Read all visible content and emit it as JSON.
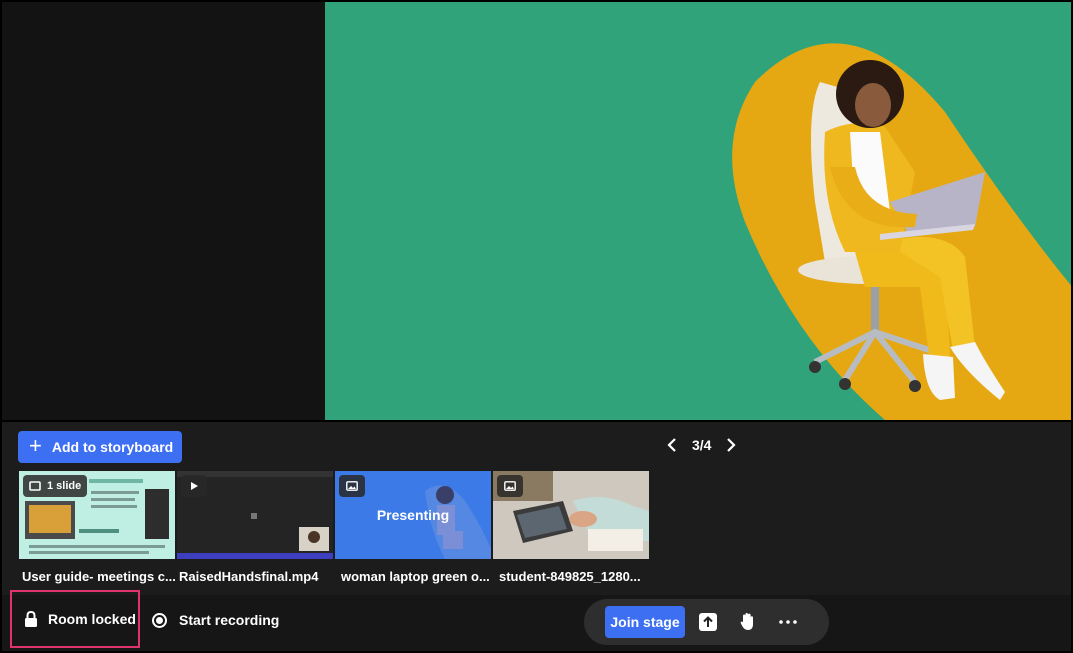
{
  "storyboard": {
    "add_label": "Add to storyboard",
    "pager": "3/4",
    "items": [
      {
        "badge": "1 slide",
        "badge_icon": "slides-icon",
        "caption": "User guide- meetings c..."
      },
      {
        "badge_icon": "play-icon",
        "caption": "RaisedHandsfinal.mp4"
      },
      {
        "badge_icon": "image-icon",
        "overlay": "Presenting",
        "caption": "woman laptop green o..."
      },
      {
        "badge_icon": "image-icon",
        "caption": "student-849825_1280..."
      }
    ]
  },
  "controls": {
    "room_locked": "Room locked",
    "start_recording": "Start recording",
    "join_stage": "Join stage"
  },
  "colors": {
    "accent": "#3d6ff2",
    "stage_green": "#31a37a",
    "highlight": "#e0336e"
  }
}
